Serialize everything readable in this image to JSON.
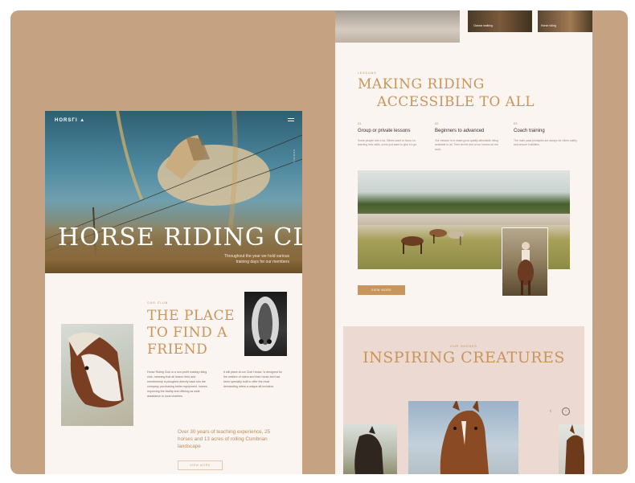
{
  "left_page": {
    "logo": "HORSΓI ▲",
    "hero_title": "HORSE RIDING CLUB",
    "hero_subtitle": "Throughout the year we hold various training days for our members",
    "hero_side_text": "SCROLL",
    "about": {
      "eyebrow": "OUR CLUB",
      "title": "THE PLACE TO FIND A FRIEND",
      "body_left": "Horse Riding Club is a non-profit making riding club, meaning that all lesson fees and membership is ploughed directly back into the company, purchasing better equipment, horses, improving the facility and offering as wide assistance to local charities.",
      "body_right": "It will place at our Club House, is designed for the welfare of riders and their horse and has been specially built to offer the most demanding riders a unique all-inclusive.",
      "quote": "Over 30 years of teaching experience, 25 horses and 13 acres of rolling Cumbrian landscape",
      "button_label": "VIEW MORE"
    }
  },
  "right_page": {
    "top_captions": [
      "Classic walking",
      "Horse riding"
    ],
    "lessons": {
      "eyebrow": "LESSONS",
      "title_line1": "MAKING RIDING",
      "title_line2": "ACCESSIBLE TO ALL",
      "features": [
        {
          "num": "01",
          "title": "Group or private lessons",
          "text": "Some people ride a lot, Others want to focus on learning new skills, some just want to give it a go."
        },
        {
          "num": "02",
          "title": "Beginners to advanced",
          "text": "Our mission is to make good quality affordable riding available to all. Then let the rest of our horses do the work."
        },
        {
          "num": "03",
          "title": "Coach training",
          "text": "The main pass principles are always for riders safety and ensure it abilities."
        }
      ],
      "button_label": "VIEW MORE"
    },
    "horses": {
      "eyebrow": "OUR HORSES",
      "title": "INSPIRING CREATURES",
      "prev_label": "‹",
      "next_label": "›"
    }
  },
  "colors": {
    "board": "#c5a382",
    "page": "#fbf5f2",
    "accent": "#c9955a",
    "section_bg": "#ecdad2"
  }
}
